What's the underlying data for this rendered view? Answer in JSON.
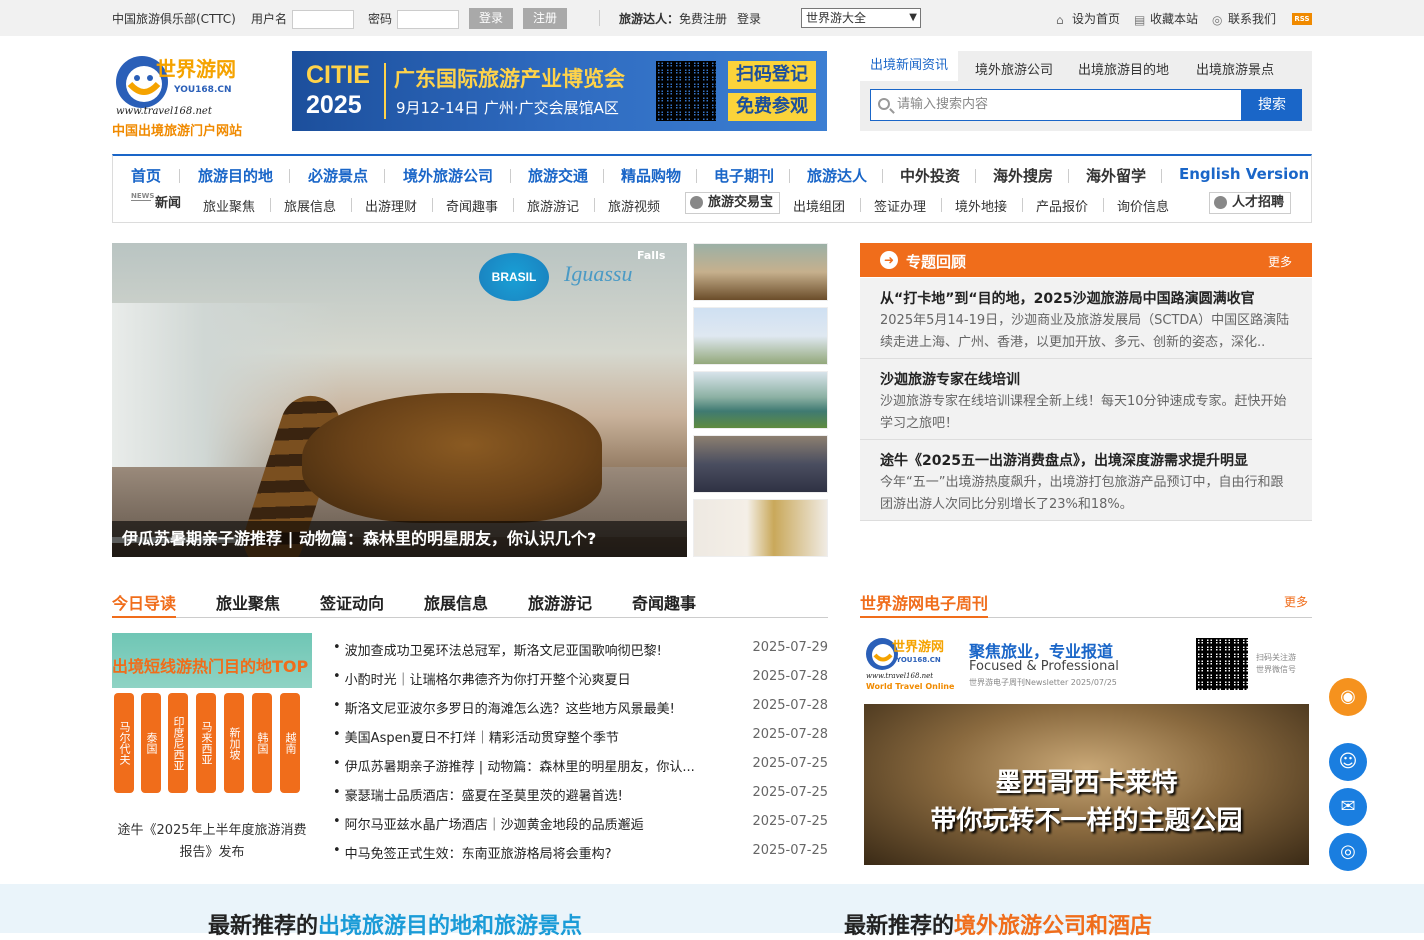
{
  "topbar": {
    "club": "中国旅游俱乐部(CTTC)",
    "username_label": "用户名",
    "password_label": "密码",
    "login": "登录",
    "register": "注册",
    "expert_prefix": "旅游达人：",
    "free_register": "免费注册",
    "expert_login": "登录",
    "select_value": "世界游大全",
    "set_home": "设为首页",
    "bookmark": "收藏本站",
    "contact": "联系我们",
    "rss": "RSS"
  },
  "header": {
    "logo_text": "世界游网",
    "logo_sub": "YOU168.CN",
    "logo_url": "www.travel168.net",
    "tagline": "中国出境旅游门户网站",
    "banner": {
      "brand": "CITIE",
      "year": "2025",
      "title": "广东国际旅游产业博览会",
      "subtitle": "9月12-14日 广州·广交会展馆A区",
      "cta1": "扫码登记",
      "cta2": "免费参观"
    }
  },
  "search": {
    "tabs": [
      "出境新闻资讯",
      "境外旅游公司",
      "出境旅游目的地",
      "出境旅游景点"
    ],
    "placeholder": "请输入搜索内容",
    "button": "搜索"
  },
  "nav": {
    "main": [
      "首页",
      "旅游目的地",
      "必游景点",
      "境外旅游公司",
      "旅游交通",
      "精品购物",
      "电子期刊",
      "旅游达人",
      "中外投资",
      "海外搜房",
      "海外留学",
      "English Version"
    ],
    "news_tag_small": "NEWS",
    "news_tag": "新闻",
    "sub_left": [
      "旅业聚焦",
      "旅展信息",
      "出游理财",
      "奇闻趣事",
      "旅游游记",
      "旅游视频"
    ],
    "trade_box": "旅游交易宝",
    "sub_right": [
      "出境组团",
      "签证办理",
      "境外地接",
      "产品报价",
      "询价信息"
    ],
    "jobs_box": "人才招聘"
  },
  "hero": {
    "badge": "BRASIL",
    "brand": "Iguassu",
    "falls": "Falls",
    "caption": "伊瓜苏暑期亲子游推荐 | 动物篇：森林里的明星朋友，你认识几个?"
  },
  "topics": {
    "title": "专题回顾",
    "more": "更多",
    "items": [
      {
        "title": "从“打卡地”到“目的地，2025沙迦旅游局中国路演圆满收官",
        "desc": "2025年5月14-19日，沙迦商业及旅游发展局（SCTDA）中国区路演陆续走进上海、广州、香港，以更加开放、多元、创新的姿态，深化.."
      },
      {
        "title": "沙迦旅游专家在线培训",
        "desc": "沙迦旅游专家在线培训课程全新上线！每天10分钟速成专家。赶快开始学习之旅吧！"
      },
      {
        "title": "途牛《2025五一出游消费盘点》，出境深度游需求提升明显",
        "desc": "今年“五一”出境游热度飙升，出境游打包旅游产品预订中，自由行和跟团游出游人次同比分别增长了23%和18%。"
      }
    ]
  },
  "reading": {
    "tabs": [
      "今日导读",
      "旅业聚焦",
      "签证动向",
      "旅展信息",
      "旅游游记",
      "奇闻趣事"
    ],
    "feature_title": "出境短线游热门目的地TOP",
    "feature_bars": [
      "马尔代夫",
      "泰国",
      "印度尼西亚",
      "马来西亚",
      "新加坡",
      "韩国",
      "越南"
    ],
    "feature_caption": "途牛《2025年上半年度旅游消费报告》发布",
    "news": [
      {
        "title": "波加查成功卫冕环法总冠军，斯洛文尼亚国歌响彻巴黎!",
        "date": "2025-07-29"
      },
      {
        "title": "小酌时光｜让瑞格尔弗德齐为你打开整个沁爽夏日",
        "date": "2025-07-28"
      },
      {
        "title": "斯洛文尼亚波尔多罗日的海滩怎么选？这些地方风景最美!",
        "date": "2025-07-28"
      },
      {
        "title": "美国Aspen夏日不打烊｜精彩活动贯穿整个季节",
        "date": "2025-07-28"
      },
      {
        "title": "伊瓜苏暑期亲子游推荐 | 动物篇：森林里的明星朋友，你认...",
        "date": "2025-07-25"
      },
      {
        "title": "豪瑟瑞士品质酒店：盛夏在圣莫里茨的避暑首选!",
        "date": "2025-07-25"
      },
      {
        "title": "阿尔马亚兹水晶广场酒店｜沙迦黄金地段的品质邂逅",
        "date": "2025-07-25"
      },
      {
        "title": "中马免签正式生效：东南亚旅游格局将会重构?",
        "date": "2025-07-25"
      }
    ]
  },
  "weekly": {
    "title": "世界游网电子周刊",
    "more": "更多",
    "slogan": "聚焦旅业，专业报道",
    "slogan_en": "Focused & Professional",
    "newsletter": "世界游电子周刊Newsletter 2025/07/25",
    "logo_sub": "World Travel Online",
    "qr_text1": "扫码关注游",
    "qr_text2": "世界微信号",
    "banner_line1": "墨西哥西卡莱特",
    "banner_line2": "带你玩转不一样的主题公园"
  },
  "bottom": {
    "left_prefix": "最新推荐的",
    "left_highlight": "出境旅游目的地和旅游景点",
    "right_prefix": "最新推荐的",
    "right_highlight": "境外旅游公司和酒店"
  },
  "colors": {
    "brand_blue": "#1a66c8",
    "accent_orange": "#f06d1b",
    "float_blue": "#1a7ee0",
    "float_orange": "#f5921e"
  }
}
